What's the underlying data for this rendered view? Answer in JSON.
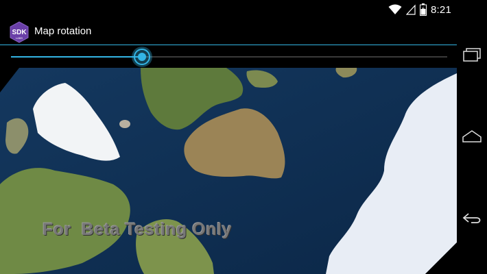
{
  "status_bar": {
    "time": "8:21",
    "icons": [
      "wifi-icon",
      "signal-icon",
      "battery-icon"
    ]
  },
  "action_bar": {
    "title": "Map rotation",
    "app_icon_text": "SDK",
    "app_icon_subtext": "LABS",
    "icon_color": "#6a3fa8"
  },
  "slider": {
    "value_fraction": 0.3,
    "accent": "#33b5e5"
  },
  "map": {
    "watermark": "For  Beta Testing Only",
    "ocean_color": "#0d2d52"
  },
  "nav_bar": {
    "buttons": [
      "recent-apps-icon",
      "home-icon",
      "back-icon"
    ]
  }
}
